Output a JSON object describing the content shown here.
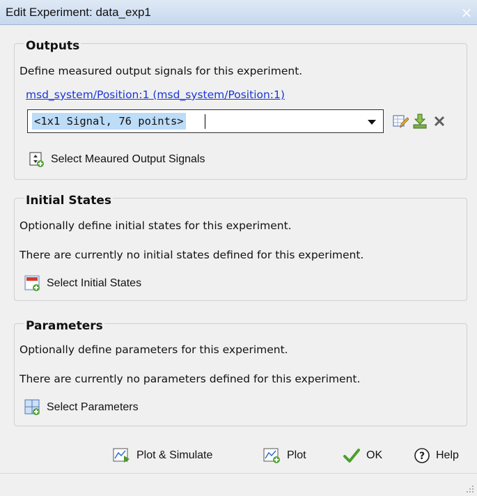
{
  "window": {
    "title": "Edit Experiment: data_exp1",
    "close_glyph": "×"
  },
  "outputs": {
    "legend": "Outputs",
    "description": "Define measured output signals for this experiment.",
    "signal_link": "msd_system/Position:1 (msd_system/Position:1)",
    "combo_value": "<1x1 Signal, 76 points>",
    "select_button": "Select Meaured Output Signals"
  },
  "initial_states": {
    "legend": "Initial States",
    "description": "Optionally define initial states for this experiment.",
    "status": "There are currently no initial states defined for this experiment.",
    "select_button": "Select Initial States"
  },
  "parameters": {
    "legend": "Parameters",
    "description": "Optionally define parameters for this experiment.",
    "status": "There are currently no parameters defined for this experiment.",
    "select_button": "Select Parameters"
  },
  "footer": {
    "plot_simulate": "Plot & Simulate",
    "plot": "Plot",
    "ok": "OK",
    "help": "Help"
  },
  "icons": {
    "edit": "edit-signal-icon",
    "import": "import-icon",
    "delete": "delete-icon",
    "select_outputs": "select-signal-icon",
    "select_states": "select-states-icon",
    "select_params": "select-parameters-icon",
    "plot_simulate": "plot-simulate-icon",
    "plot": "plot-icon",
    "ok": "checkmark-icon",
    "help": "help-icon"
  },
  "colors": {
    "link": "#1a35d6",
    "selection": "#bcdcf8",
    "window_bg": "#f0f0f0",
    "titlebar": "#c6d8ee"
  }
}
